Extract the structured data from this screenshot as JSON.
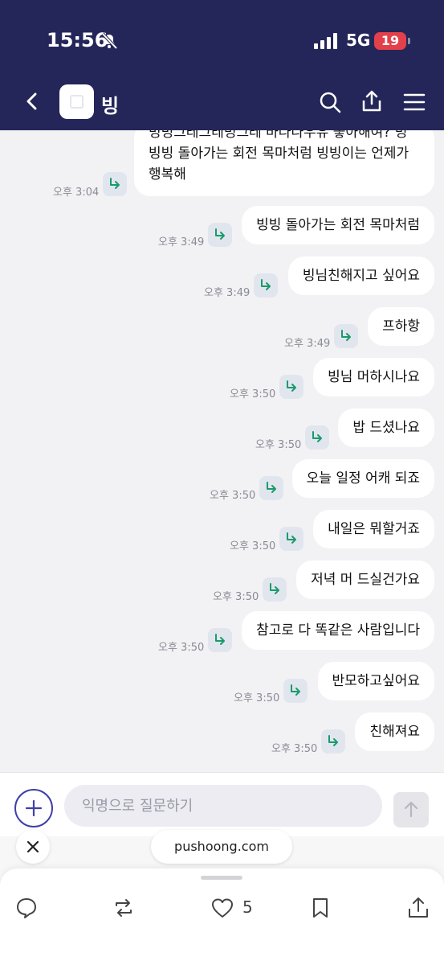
{
  "status_bar": {
    "time": "15:56",
    "network": "5G",
    "battery": "19"
  },
  "header": {
    "title": "빙"
  },
  "messages": [
    {
      "lines": [
        "빙빙그레그레빙그레 바나나우유 좋아해여? 빙",
        "빙빙 돌아가는 회전 목마처럼 빙빙이는 언제가",
        "행복해"
      ],
      "time": "오후 3:04"
    },
    {
      "text": "빙빙 돌아가는 회전 목마처럼",
      "time": "오후 3:49"
    },
    {
      "text": "빙님친해지고 싶어요",
      "time": "오후 3:49"
    },
    {
      "text": "프하항",
      "time": "오후 3:49"
    },
    {
      "text": "빙님 머하시나요",
      "time": "오후 3:50"
    },
    {
      "text": "밥 드셨나요",
      "time": "오후 3:50"
    },
    {
      "text": "오늘 일정 어캐 되죠",
      "time": "오후 3:50"
    },
    {
      "text": "내일은 뭐할거죠",
      "time": "오후 3:50"
    },
    {
      "text": "저녁 머 드실건가요",
      "time": "오후 3:50"
    },
    {
      "text": "참고로 다 똑같은 사람입니다",
      "time": "오후 3:50"
    },
    {
      "text": "반모하고싶어요",
      "time": "오후 3:50"
    },
    {
      "text": "친해져요",
      "time": "오후 3:50"
    }
  ],
  "input": {
    "placeholder": "익명으로 질문하기",
    "value": ""
  },
  "ad": {
    "url": "pushoong.com"
  },
  "actions": {
    "like_count": "5"
  },
  "colors": {
    "header_bg": "#242659",
    "chat_bg": "#f2f2f4",
    "reply_arrow": "#1a9a6c",
    "accent": "#3f3fa8"
  },
  "icons": [
    "back-icon",
    "search-icon",
    "share-icon",
    "menu-icon",
    "reply-icon",
    "plus-icon",
    "send-arrow-icon",
    "close-icon",
    "comment-icon",
    "retweet-icon",
    "heart-icon",
    "bookmark-icon",
    "upload-icon"
  ]
}
